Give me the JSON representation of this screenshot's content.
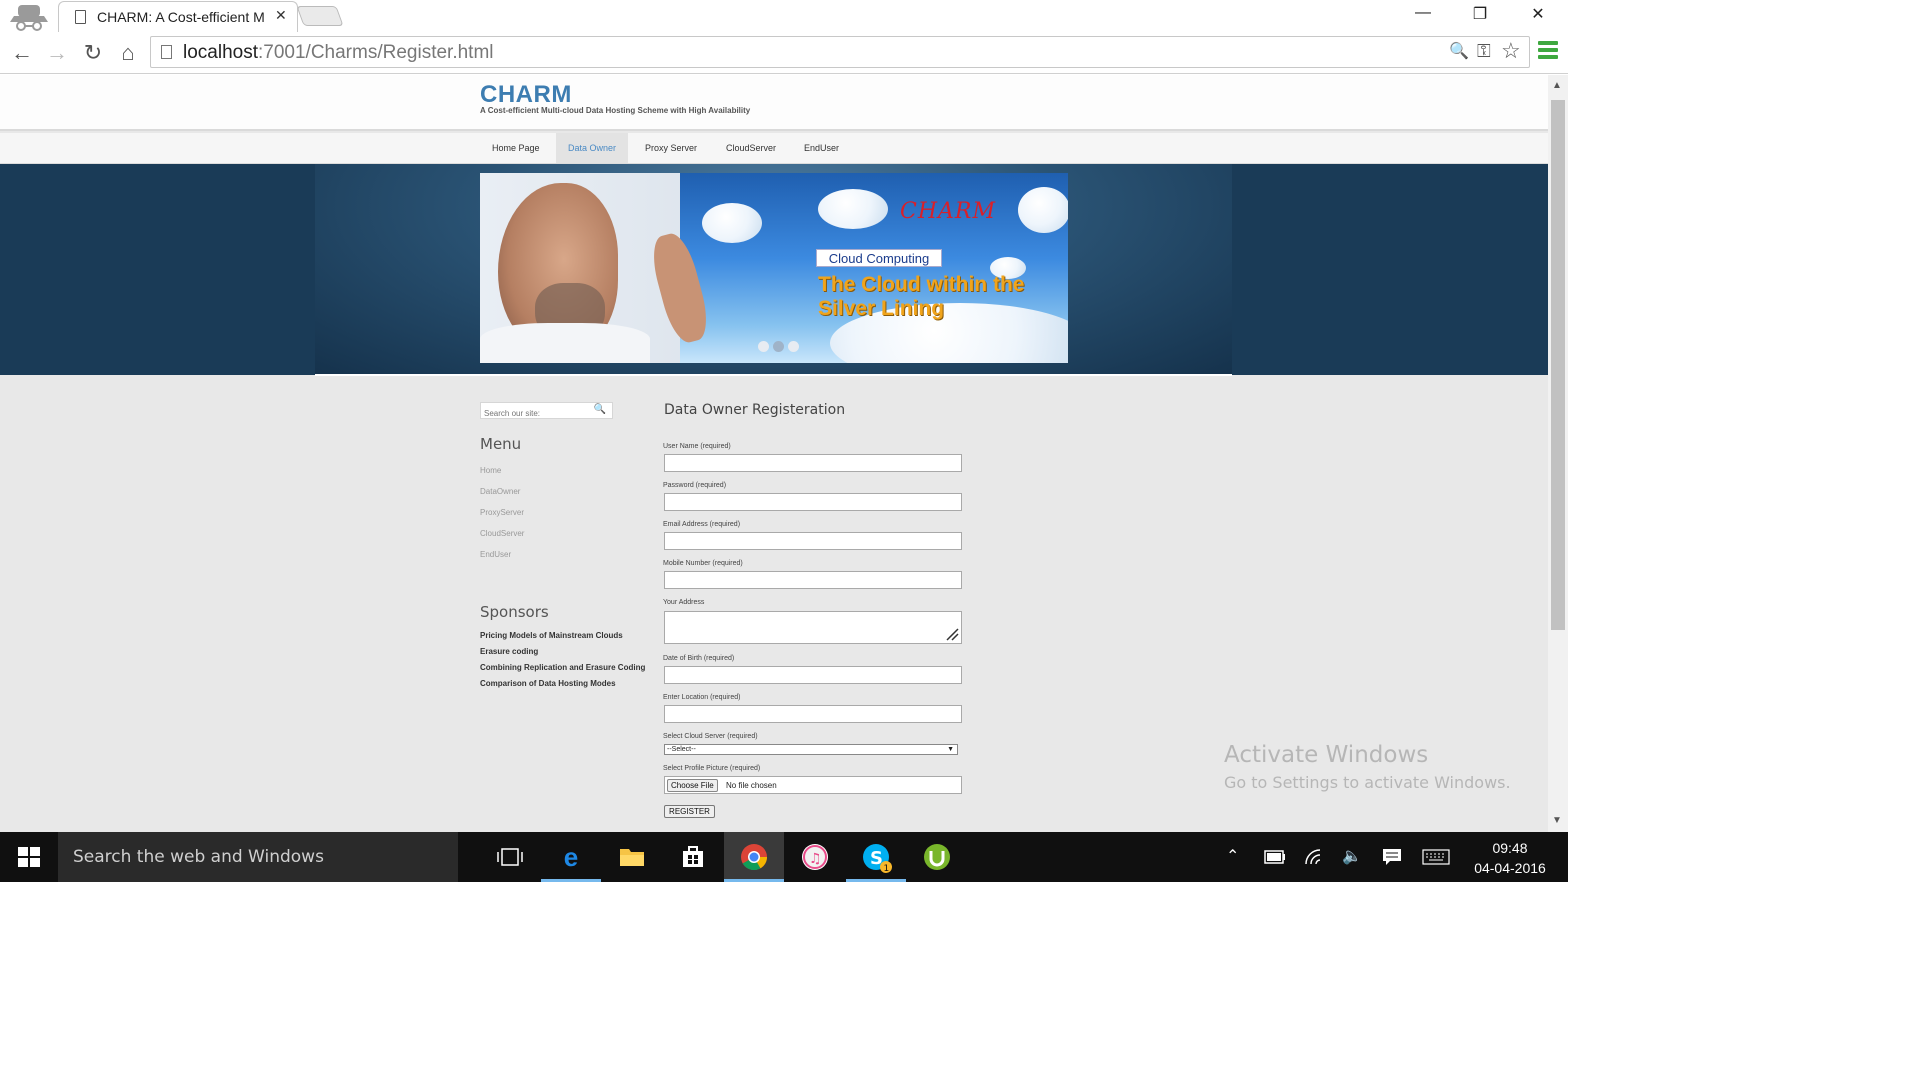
{
  "browser": {
    "tab_title": "CHARM: A Cost-efficient M",
    "url_host": "localhost",
    "url_rest": ":7001/Charms/Register.html",
    "close_glyph": "✕",
    "win_minimize": "—",
    "win_restore": "❐",
    "win_close": "✕",
    "back": "←",
    "forward": "→",
    "reload": "↻",
    "home": "⌂",
    "zoom_icon": "🔍",
    "key_icon": "⚿",
    "star_icon": "☆"
  },
  "site": {
    "logo": "CHARM",
    "tagline": "A Cost-efficient Multi-cloud Data Hosting Scheme with High Availability",
    "nav": [
      "Home Page",
      "Data Owner",
      "Proxy Server",
      "CloudServer",
      "EndUser"
    ],
    "active_nav": "Data Owner",
    "slide": {
      "brand": "CHARM",
      "tag": "Cloud Computing",
      "headline_1": "The Cloud within the",
      "headline_2": "Silver Lining"
    }
  },
  "sidebar": {
    "search_placeholder": "Search our site:",
    "menu_heading": "Menu",
    "menu": [
      "Home",
      "DataOwner",
      "ProxyServer",
      "CloudServer",
      "EndUser"
    ],
    "sponsors_heading": "Sponsors",
    "sponsors": [
      "Pricing Models of Mainstream Clouds",
      "Erasure coding",
      "Combining Replication and Erasure Coding",
      "Comparison of Data Hosting Modes"
    ]
  },
  "form": {
    "title": "Data Owner Registeration",
    "fields": [
      {
        "label": "User Name (required)",
        "value": ""
      },
      {
        "label": "Password (required)",
        "value": ""
      },
      {
        "label": "Email Address (required)",
        "value": ""
      },
      {
        "label": "Mobile Number (required)",
        "value": ""
      }
    ],
    "address_label": "Your Address",
    "dob_label": "Date of Birth (required)",
    "location_label": "Enter Location (required)",
    "cloud_label": "Select Cloud Server (required)",
    "cloud_selected": "--Select--",
    "picture_label": "Select Profile Picture (required)",
    "choose_file": "Choose File",
    "no_file": "No file chosen",
    "register": "REGISTER"
  },
  "watermark": {
    "line1": "Activate Windows",
    "line2": "Go to Settings to activate Windows."
  },
  "taskbar": {
    "search_text": "Search the web and Windows",
    "time": "09:48",
    "date": "04-04-2016",
    "skype_badge": "1"
  },
  "colors": {
    "accent_blue": "#3d7db1",
    "nav_active": "#4a8ac4",
    "chrome_menu": "#3ea83f",
    "taskbar": "#101010"
  }
}
